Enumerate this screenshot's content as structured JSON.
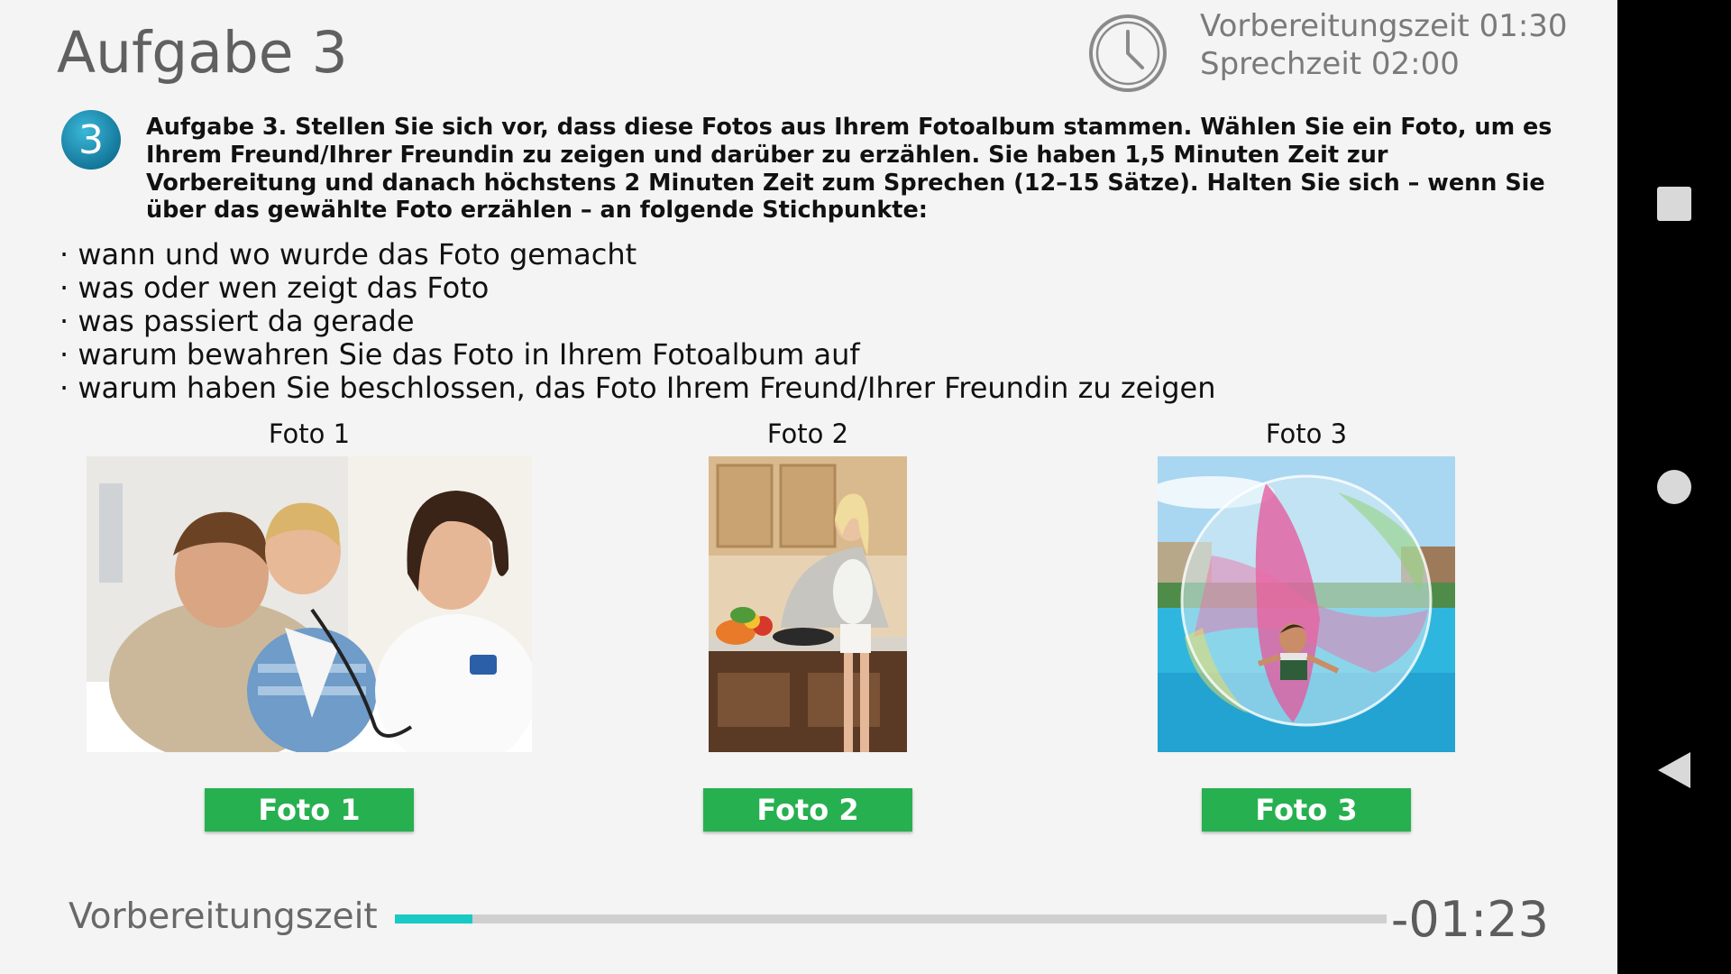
{
  "title": "Aufgabe 3",
  "timer_info": {
    "preparation": "Vorbereitungszeit 01:30",
    "speaking": "Sprechzeit 02:00"
  },
  "task_badge": "3",
  "instruction": "Aufgabe 3. Stellen Sie sich vor, dass diese Fotos aus Ihrem Fotoalbum stammen. Wählen Sie ein Foto, um es Ihrem Freund/Ihrer Freundin zu zeigen und darüber zu erzählen. Sie haben 1,5 Minuten Zeit zur Vorbereitung und danach höchstens 2 Minuten Zeit zum Sprechen (12–15 Sätze). Halten Sie sich – wenn Sie über das gewählte Foto erzählen – an folgende Stichpunkte:",
  "bullets": [
    "wann und wo wurde das Foto gemacht",
    "was oder wen zeigt das Foto",
    "was passiert da gerade",
    "warum bewahren Sie das Foto in Ihrem Fotoalbum auf",
    "warum haben Sie beschlossen, das Foto Ihrem Freund/Ihrer Freundin zu zeigen"
  ],
  "photos": [
    {
      "caption": "Foto 1",
      "button": "Foto 1"
    },
    {
      "caption": "Foto 2",
      "button": "Foto 2"
    },
    {
      "caption": "Foto 3",
      "button": "Foto 3"
    }
  ],
  "footer": {
    "label": "Vorbereitungszeit",
    "progress": 0.078,
    "remaining": "-01:23"
  },
  "colors": {
    "accent_green": "#27b050",
    "progress_teal": "#19c9c4",
    "badge_blue": "#1a8fb5"
  },
  "nav": {
    "recents_icon": "square-recents-icon",
    "home_icon": "circle-home-icon",
    "back_icon": "triangle-back-icon"
  }
}
